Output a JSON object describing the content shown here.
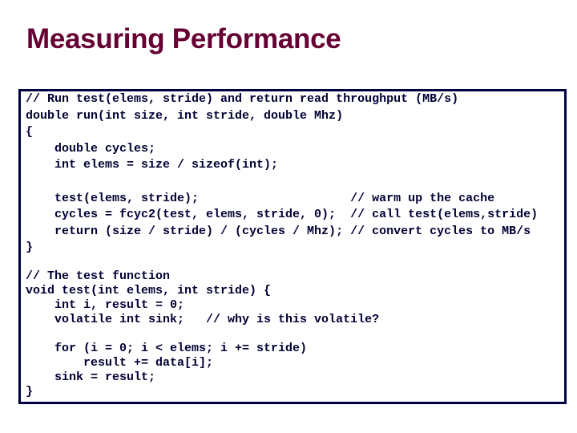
{
  "slide": {
    "title": "Measuring Performance",
    "title_color": "#660033",
    "border_color": "#000040",
    "code_color": "#000033"
  },
  "code": {
    "run_function": [
      "// Run test(elems, stride) and return read throughput (MB/s)",
      "double run(int size, int stride, double Mhz)",
      "{",
      "    double cycles;",
      "    int elems = size / sizeof(int);",
      "",
      "    test(elems, stride);                     // warm up the cache",
      "    cycles = fcyc2(test, elems, stride, 0);  // call test(elems,stride)",
      "    return (size / stride) / (cycles / Mhz); // convert cycles to MB/s",
      "}"
    ],
    "test_function": [
      "// The test function",
      "void test(int elems, int stride) {",
      "    int i, result = 0;",
      "    volatile int sink;   // why is this volatile?",
      "",
      "    for (i = 0; i < elems; i += stride)",
      "        result += data[i];",
      "    sink = result;",
      "}"
    ]
  }
}
